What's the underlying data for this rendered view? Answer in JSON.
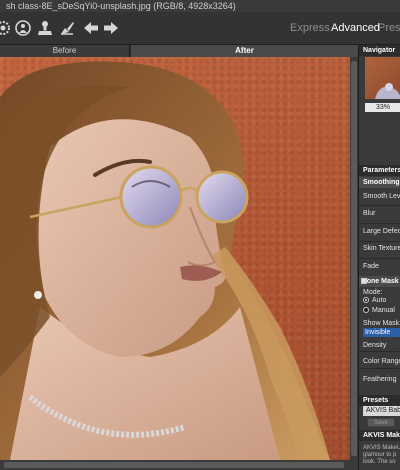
{
  "window": {
    "title": "sh class-8E_sDeSqYi0-unsplash.jpg (RGB/8, 4928x3264)"
  },
  "toolbar": {
    "icons": [
      "gear-icon",
      "run-icon",
      "stamp-icon",
      "brush-icon",
      "undo-arrow-icon",
      "redo-arrow-icon"
    ],
    "modes": [
      "Express",
      "Advanced",
      "Prese"
    ],
    "active_mode": "Advanced"
  },
  "tabs": {
    "before": "Before",
    "after": "After"
  },
  "navigator": {
    "title": "Navigator",
    "zoom": "33%"
  },
  "parameters": {
    "title": "Parameters",
    "smoothing": "Smoothing",
    "smooth_level": "Smooth Leve",
    "blur": "Blur",
    "large_defects": "Large Defect",
    "skin_texture": "Skin Texture",
    "fade": "Fade",
    "tone_mask": "Tone Mask",
    "mode_label": "Mode:",
    "mode_auto": "Auto",
    "mode_manual": "Manual",
    "show_mask_label": "Show Mask:",
    "show_mask_value": "Invisible",
    "density": "Density",
    "color_range": "Color Range",
    "feathering": "Feathering"
  },
  "presets": {
    "title": "Presets",
    "selected": "AKVIS Baby S",
    "save": "Save"
  },
  "info": {
    "title": "AKVIS Make",
    "lines": [
      "AKVIS MakeU",
      "glamour to p",
      "look. The so"
    ]
  },
  "colors": {
    "accent": "#2d5fa8",
    "panel": "#3a3a3a",
    "background": "#2b2b2b"
  }
}
